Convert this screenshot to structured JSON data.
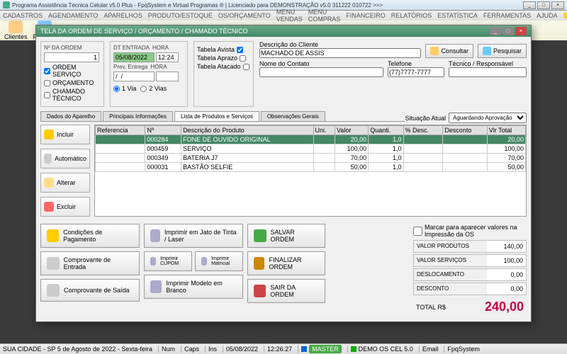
{
  "app": {
    "title": "Programa Assistência Técnica Celular v5.0 Plus - FpqSystem e Virtual Programas ® | Licenciado para  DEMONSTRAÇÃO v5.0 311222 010722 >>>"
  },
  "menu": {
    "items": [
      "CADASTROS",
      "AGENDAMENTO",
      "APARELHOS",
      "PRODUTO/ESTOQUE",
      "OS/ORÇAMENTO",
      "MENU VENDAS",
      "MENU COMPRAS",
      "FINANCEIRO",
      "RELATÓRIOS",
      "ESTATÍSTICA",
      "FERRAMENTAS",
      "AJUDA"
    ],
    "email": "E-MAIL"
  },
  "toolbar": {
    "clientes": "Clientes",
    "fornece": "Fornece"
  },
  "modal": {
    "title": "TELA DA ORDEM DE SERVIÇO / ORÇAMENTO / CHAMADO TÉCNICO",
    "ordem_lbl": "Nº DA ORDEM",
    "ordem_val": "1",
    "chk_os": "ORDEM SERVIÇO",
    "chk_orc": "ORÇAMENTO",
    "chk_cham": "CHAMADO TÉCNICO",
    "dt_entrada_lbl": "DT ENTRADA",
    "dt_entrada": "05/08/2022",
    "hora_lbl": "HORA",
    "hora": "12:24",
    "prev_lbl": "Prev. Entrega",
    "prev_val": "/  /",
    "r_1via": "1 Via",
    "r_2vias": "2 Vias",
    "tbl_avista": "Tabela Avista",
    "tbl_aprazo": "Tabela Aprazo",
    "tbl_atacado": "Tabela Atacado",
    "desc_cliente_lbl": "Descrição do Cliente",
    "desc_cliente": "MACHADO DE ASSIS",
    "nome_contato_lbl": "Nome do Contato",
    "nome_contato": "",
    "telefone_lbl": "Telefone",
    "telefone": "(77)7777-7777",
    "tecnico_lbl": "Técnico / Responsável",
    "tecnico": "",
    "btn_consultar": "Consultar",
    "btn_pesquisar": "Pesquisar",
    "tabs": [
      "Dados do Aparelho",
      "Principais Informações",
      "Lista de Produtos e Serviços",
      "Observações Gerais"
    ],
    "situacao_lbl": "Situação Atual",
    "situacao_val": "Aguardando Aprovação",
    "side": {
      "incluir": "Incluir",
      "automatico": "Automático",
      "alterar": "Alterar",
      "excluir": "Excluir"
    },
    "cols": [
      "Referencia",
      "Nº",
      "Descrição do Produto",
      "Uni.",
      "Valor",
      "Quanti.",
      "% Desc.",
      "Desconto",
      "Vlr Total"
    ],
    "rows": [
      {
        "ref": "",
        "n": "000284",
        "desc": "FONE DE OUVIDO ORIGINAL",
        "uni": "",
        "valor": "20,00",
        "quant": "1,0",
        "pdesc": "",
        "desc2": "",
        "vtot": "20,00",
        "sel": true
      },
      {
        "ref": "",
        "n": "000459",
        "desc": "SERVIÇO",
        "uni": "",
        "valor": "100,00",
        "quant": "1,0",
        "pdesc": "",
        "desc2": "",
        "vtot": "100,00"
      },
      {
        "ref": "",
        "n": "000349",
        "desc": "BATERIA J7",
        "uni": "",
        "valor": "70,00",
        "quant": "1,0",
        "pdesc": "",
        "desc2": "",
        "vtot": "70,00"
      },
      {
        "ref": "",
        "n": "000031",
        "desc": "BASTÃO SELFIE",
        "uni": "",
        "valor": "50,00",
        "quant": "1,0",
        "pdesc": "",
        "desc2": "",
        "vtot": "50,00"
      }
    ],
    "bottom": {
      "cond_pag": "Condições de Pagamento",
      "imp_jato": "Imprimir em Jato de Tinta / Laser",
      "salvar": "SALVAR ORDEM",
      "comp_ent": "Comprovante de Entrada",
      "imp_cupom": "Imprimir CUPOM",
      "imp_matr": "Imprimir Matricial",
      "finalizar": "FINALIZAR ORDEM",
      "comp_saida": "Comprovante de Saída",
      "imp_branco": "Imprimir Modelo em Branco",
      "sair": "SAIR DA ORDEM"
    },
    "totals": {
      "chk": "Marcar para aparecer valores na Impressão da OS",
      "vprod_lbl": "VALOR PRODUTOS",
      "vprod": "140,00",
      "vserv_lbl": "VALOR SERVIÇOS",
      "vserv": "100,00",
      "desloc_lbl": "DESLOCAMENTO",
      "desloc": "0,00",
      "desc_lbl": "DESCONTO",
      "desc": "0,00",
      "total_lbl": "TOTAL R$",
      "total": "240,00"
    }
  },
  "status": {
    "loc": "SUA CIDADE - SP  5 de Agosto de 2022 - Sexta-feira",
    "num": "Num",
    "caps": "Caps",
    "ins": "Ins",
    "date": "05/08/2022",
    "time": "12:26:27",
    "master": "MASTER",
    "demo": "DEMO OS CEL 5.0",
    "email": "Email",
    "fpq": "FpqSystem"
  }
}
